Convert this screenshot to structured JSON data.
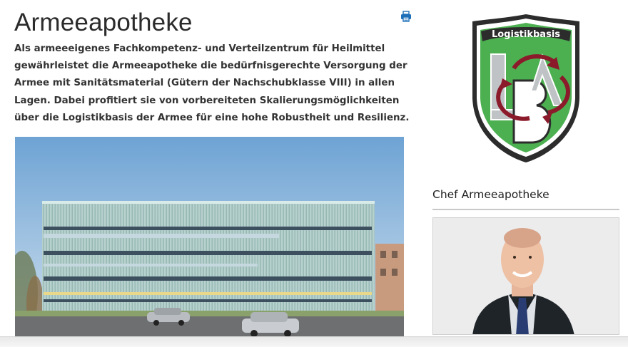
{
  "page": {
    "title": "Armeeapotheke",
    "lead": "Als armeeeigenes Fachkompetenz- und Verteilzentrum für Heilmittel gewährleistet die Armeeapotheke die bedürfnisgerechte Versorgung der Armee mit Sanitätsmaterial (Gütern der Nachschubklasse VIII) in allen Lagen. Dabei profitiert sie von vorbereiteten Skalierungsmöglichkeiten über die Logistikbasis der Armee für eine hohe Robustheit und Resilienz.",
    "print_icon": "printer-icon"
  },
  "sidebar": {
    "logo_text": "Logistikbasis",
    "logo_letters": "LBA",
    "chef_heading": "Chef Armeeapotheke"
  },
  "colors": {
    "print_icon": "#1e6fb8",
    "logo_green": "#4caf50",
    "logo_red": "#8b1a2b",
    "logo_dark": "#2c2c2c"
  }
}
